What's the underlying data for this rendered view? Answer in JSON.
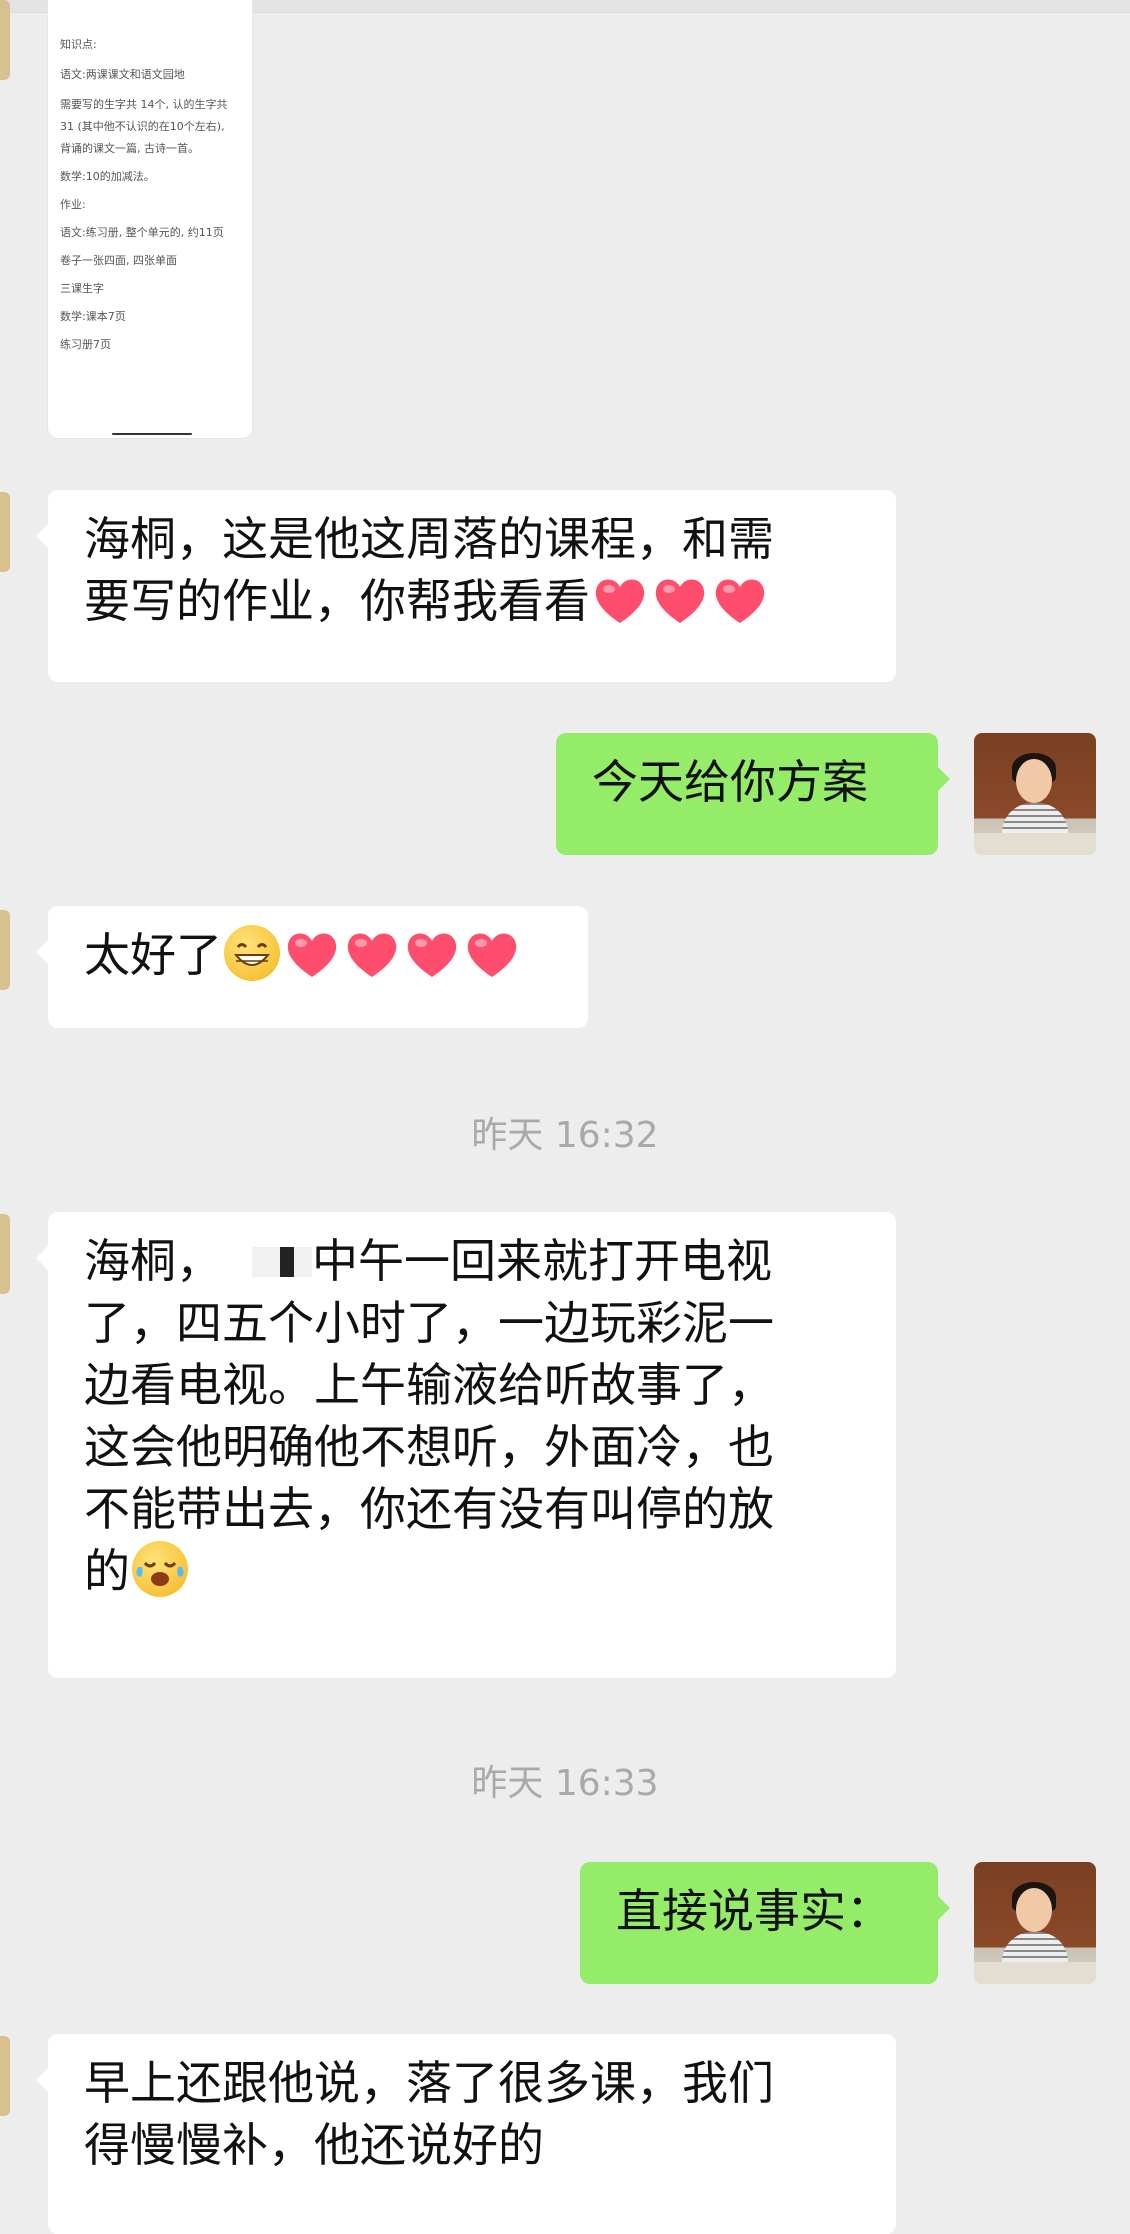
{
  "card": {
    "lines": [
      "知识点:",
      "语文:两课课文和语文园地",
      "需要写的生字共 14个, 认的生字共",
      "31 (其中他不认识的在10个左右),",
      "背诵的课文一篇, 古诗一首。",
      "数学:10的加减法。",
      "作业:",
      "语文:练习册, 整个单元的, 约11页",
      "卷子一张四面, 四张单面",
      "三课生字",
      "数学:课本7页",
      "练习册7页"
    ]
  },
  "messages": [
    {
      "id": "m1",
      "side": "left",
      "lines": [
        "海桐，这是他这周落的课程，和需",
        "要写的作业，你帮我看看"
      ]
    },
    {
      "id": "m2",
      "side": "right",
      "text": "今天给你方案"
    },
    {
      "id": "m3",
      "side": "left",
      "text": "太好了"
    },
    {
      "id": "t1",
      "time": "昨天 16:32"
    },
    {
      "id": "m4",
      "side": "left",
      "lines": [
        "海桐，",
        "中午一回来就打开电视",
        "了，四五个小时了，一边玩彩泥一",
        "边看电视。上午输液给听故事了，",
        "这会他明确他不想听，外面冷，也",
        "不能带出去，你还有没有叫停的放",
        "的"
      ]
    },
    {
      "id": "t2",
      "time": "昨天 16:33"
    },
    {
      "id": "m5",
      "side": "right",
      "text": "直接说事实："
    },
    {
      "id": "m6",
      "side": "left",
      "lines": [
        "早上还跟他说，落了很多课，我们",
        "得慢慢补，他还说好的"
      ]
    }
  ],
  "colors": {
    "self_bubble": "#95ec69",
    "other_bubble": "#ffffff",
    "background": "#ededed",
    "timestamp": "#a9a9a9"
  },
  "icons": {
    "heart": "heart-emoji",
    "grin": "grinning-emoji",
    "cry": "crying-laughing-emoji"
  }
}
